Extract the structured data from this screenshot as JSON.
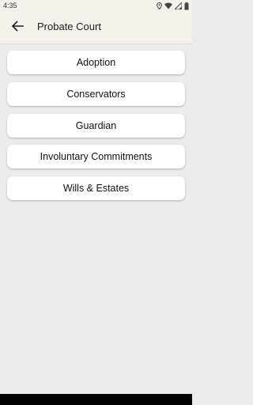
{
  "status_bar": {
    "time": "4:35",
    "icons": [
      "location-icon",
      "wifi-icon",
      "signal-icon",
      "battery-icon"
    ]
  },
  "app_bar": {
    "back_icon": "arrow-left-icon",
    "title": "Probate Court"
  },
  "menu": {
    "items": [
      {
        "label": "Adoption"
      },
      {
        "label": "Conservators"
      },
      {
        "label": "Guardian"
      },
      {
        "label": "Involuntary Commitments"
      },
      {
        "label": "Wills & Estates"
      }
    ]
  },
  "colors": {
    "app_bar_background": "#f5f2e9",
    "page_background": "#ececec",
    "card_background": "#ffffff"
  }
}
